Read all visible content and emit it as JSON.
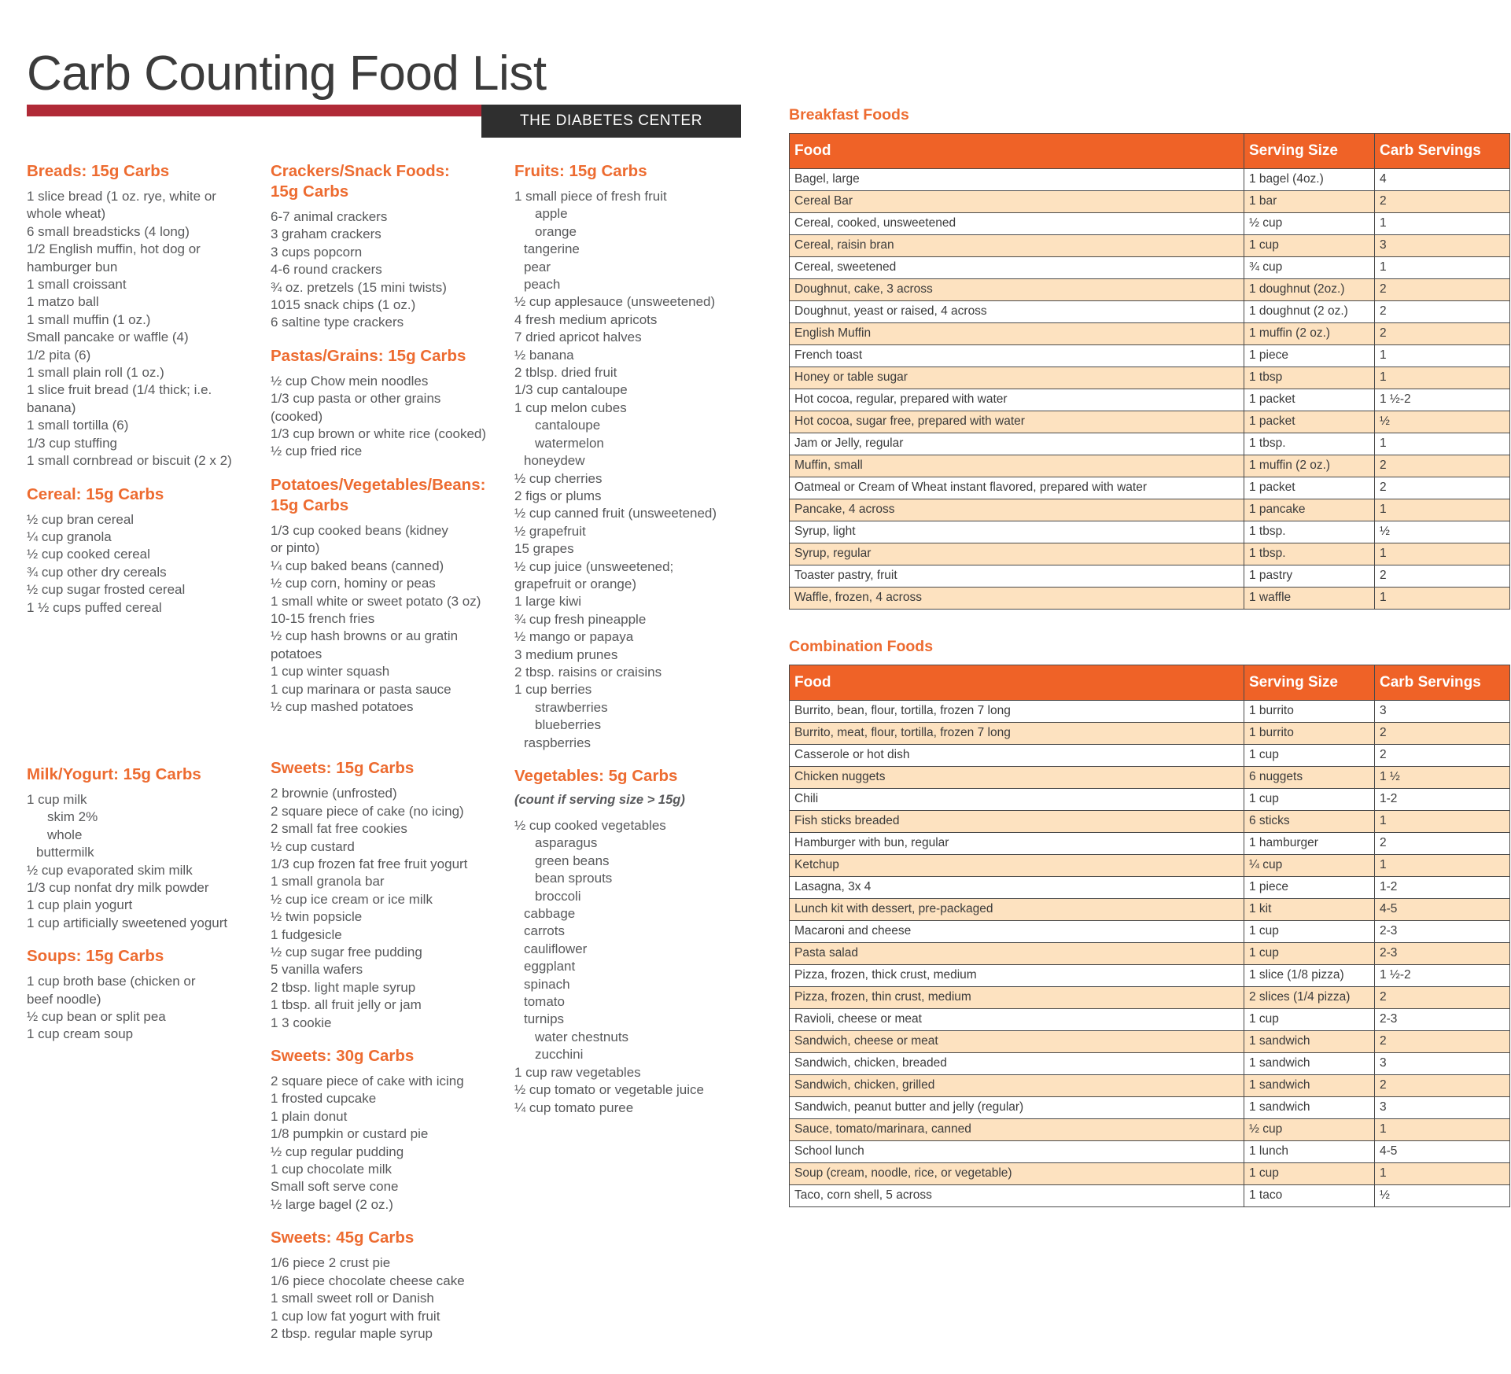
{
  "header": {
    "title": "Carb Counting Food List",
    "badge": "THE DIABETES CENTER",
    "accent_orange": "#ed6b30",
    "accent_red": "#b02a37",
    "badge_bg": "#2f2f2f"
  },
  "columns": [
    {
      "sections": [
        {
          "title": "Breads: 15g Carbs",
          "items": [
            {
              "text": "1 slice bread (1 oz. rye, white or",
              "indent": 0
            },
            {
              "text": "whole wheat)",
              "indent": 0
            },
            {
              "text": "6 small breadsticks (4 long)",
              "indent": 0
            },
            {
              "text": "1/2 English muffin, hot dog or",
              "indent": 0
            },
            {
              "text": "hamburger bun",
              "indent": 0
            },
            {
              "text": "1 small croissant",
              "indent": 0
            },
            {
              "text": "1 matzo ball",
              "indent": 0
            },
            {
              "text": "1 small muffin (1 oz.)",
              "indent": 0
            },
            {
              "text": "Small pancake or waffle (4)",
              "indent": 0
            },
            {
              "text": "1/2 pita (6)",
              "indent": 0
            },
            {
              "text": "1 small plain roll (1 oz.)",
              "indent": 0
            },
            {
              "text": "1 slice fruit bread (1/4 thick; i.e.",
              "indent": 0
            },
            {
              "text": "banana)",
              "indent": 0
            },
            {
              "text": "1 small tortilla (6)",
              "indent": 0
            },
            {
              "text": "1/3 cup stuffing",
              "indent": 0
            },
            {
              "text": "1 small cornbread or biscuit (2 x 2)",
              "indent": 0
            }
          ]
        },
        {
          "title": "Cereal: 15g Carbs",
          "items": [
            {
              "text": "½ cup bran cereal",
              "indent": 0
            },
            {
              "text": "¼ cup granola",
              "indent": 0
            },
            {
              "text": "½ cup cooked cereal",
              "indent": 0
            },
            {
              "text": "¾ cup other dry cereals",
              "indent": 0
            },
            {
              "text": "½ cup sugar frosted cereal",
              "indent": 0
            },
            {
              "text": "1 ½ cups puffed cereal",
              "indent": 0
            }
          ]
        },
        {
          "title": "Milk/Yogurt: 15g Carbs",
          "top_gap": 170,
          "items": [
            {
              "text": "1 cup milk",
              "indent": 0
            },
            {
              "text": "skim 2%",
              "indent": 1
            },
            {
              "text": "whole",
              "indent": 1
            },
            {
              "text": "buttermilk",
              "indent": 2
            },
            {
              "text": "½ cup evaporated skim milk",
              "indent": 0
            },
            {
              "text": "1/3 cup nonfat dry milk powder",
              "indent": 0
            },
            {
              "text": "1 cup plain yogurt",
              "indent": 0
            },
            {
              "text": "1 cup artificially sweetened yogurt",
              "indent": 0
            }
          ]
        },
        {
          "title": "Soups: 15g Carbs",
          "items": [
            {
              "text": "1 cup broth base (chicken or",
              "indent": 0
            },
            {
              "text": "beef noodle)",
              "indent": 0
            },
            {
              "text": "½ cup bean or split pea",
              "indent": 0
            },
            {
              "text": "1 cup cream soup",
              "indent": 0
            }
          ]
        }
      ]
    },
    {
      "sections": [
        {
          "title": "Crackers/Snack Foods:\n15g Carbs",
          "items": [
            {
              "text": "6-7 animal crackers",
              "indent": 0
            },
            {
              "text": "3 graham crackers",
              "indent": 0
            },
            {
              "text": "3 cups popcorn",
              "indent": 0
            },
            {
              "text": "4-6 round crackers",
              "indent": 0
            },
            {
              "text": "¾ oz. pretzels (15 mini twists)",
              "indent": 0
            },
            {
              "text": "1015 snack chips (1 oz.)",
              "indent": 0
            },
            {
              "text": "6 saltine type crackers",
              "indent": 0
            }
          ]
        },
        {
          "title": "Pastas/Grains: 15g Carbs",
          "items": [
            {
              "text": "½ cup Chow mein noodles",
              "indent": 0
            },
            {
              "text": "1/3 cup pasta or other grains",
              "indent": 0
            },
            {
              "text": "(cooked)",
              "indent": 0
            },
            {
              "text": "1/3 cup brown or white rice (cooked)",
              "indent": 0
            },
            {
              "text": "½ cup fried rice",
              "indent": 0
            }
          ]
        },
        {
          "title": "Potatoes/Vegetables/Beans:\n15g Carbs",
          "items": [
            {
              "text": "1/3 cup cooked beans (kidney",
              "indent": 0
            },
            {
              "text": "or pinto)",
              "indent": 0
            },
            {
              "text": "¼ cup baked beans (canned)",
              "indent": 0
            },
            {
              "text": "½ cup corn, hominy or peas",
              "indent": 0
            },
            {
              "text": "1 small white or sweet potato (3 oz)",
              "indent": 0
            },
            {
              "text": "10-15 french fries",
              "indent": 0
            },
            {
              "text": "½ cup hash browns or au gratin",
              "indent": 0
            },
            {
              "text": "potatoes",
              "indent": 0
            },
            {
              "text": "1 cup winter squash",
              "indent": 0
            },
            {
              "text": "1 cup marinara or pasta sauce",
              "indent": 0
            },
            {
              "text": "½ cup mashed potatoes",
              "indent": 0
            }
          ]
        },
        {
          "title": "Sweets: 15g Carbs",
          "top_gap": 36,
          "items": [
            {
              "text": "2 brownie (unfrosted)",
              "indent": 0
            },
            {
              "text": "2 square piece of cake (no icing)",
              "indent": 0
            },
            {
              "text": "2 small fat free cookies",
              "indent": 0
            },
            {
              "text": "½ cup custard",
              "indent": 0
            },
            {
              "text": "1/3 cup frozen fat free fruit yogurt",
              "indent": 0
            },
            {
              "text": "1 small granola bar",
              "indent": 0
            },
            {
              "text": "½ cup ice cream or ice milk",
              "indent": 0
            },
            {
              "text": "½ twin popsicle",
              "indent": 0
            },
            {
              "text": "1 fudgesicle",
              "indent": 0
            },
            {
              "text": "½ cup sugar free pudding",
              "indent": 0
            },
            {
              "text": "5 vanilla wafers",
              "indent": 0
            },
            {
              "text": "2 tbsp. light maple syrup",
              "indent": 0
            },
            {
              "text": "1 tbsp. all fruit jelly or jam",
              "indent": 0
            },
            {
              "text": "1 3 cookie",
              "indent": 0
            }
          ]
        },
        {
          "title": "Sweets: 30g Carbs",
          "items": [
            {
              "text": "2 square piece of cake with icing",
              "indent": 0
            },
            {
              "text": "1 frosted cupcake",
              "indent": 0
            },
            {
              "text": "1 plain donut",
              "indent": 0
            },
            {
              "text": "1/8 pumpkin or custard pie",
              "indent": 0
            },
            {
              "text": "½ cup regular pudding",
              "indent": 0
            },
            {
              "text": "1 cup chocolate milk",
              "indent": 0
            },
            {
              "text": "Small soft serve cone",
              "indent": 0
            },
            {
              "text": "½ large bagel (2 oz.)",
              "indent": 0
            }
          ]
        },
        {
          "title": "Sweets: 45g Carbs",
          "items": [
            {
              "text": "1/6 piece 2 crust pie",
              "indent": 0
            },
            {
              "text": "1/6 piece chocolate cheese cake",
              "indent": 0
            },
            {
              "text": "1 small sweet roll or Danish",
              "indent": 0
            },
            {
              "text": "1 cup low fat yogurt with fruit",
              "indent": 0
            },
            {
              "text": "2 tbsp. regular maple syrup",
              "indent": 0
            }
          ]
        }
      ]
    },
    {
      "sections": [
        {
          "title": "Fruits: 15g Carbs",
          "items": [
            {
              "text": "1 small piece of fresh fruit",
              "indent": 0
            },
            {
              "text": "apple",
              "indent": 1
            },
            {
              "text": "orange",
              "indent": 1
            },
            {
              "text": "tangerine",
              "indent": 2
            },
            {
              "text": "pear",
              "indent": 2
            },
            {
              "text": "peach",
              "indent": 2
            },
            {
              "text": "½ cup applesauce (unsweetened)",
              "indent": 0
            },
            {
              "text": "4 fresh medium apricots",
              "indent": 0
            },
            {
              "text": "7 dried apricot halves",
              "indent": 0
            },
            {
              "text": "½ banana",
              "indent": 0
            },
            {
              "text": "2 tblsp. dried fruit",
              "indent": 0
            },
            {
              "text": "1/3 cup cantaloupe",
              "indent": 0
            },
            {
              "text": "1 cup melon cubes",
              "indent": 0
            },
            {
              "text": "cantaloupe",
              "indent": 1
            },
            {
              "text": "watermelon",
              "indent": 1
            },
            {
              "text": "honeydew",
              "indent": 2
            },
            {
              "text": "½ cup cherries",
              "indent": 0
            },
            {
              "text": "2 figs or plums",
              "indent": 0
            },
            {
              "text": "½ cup canned fruit (unsweetened)",
              "indent": 0
            },
            {
              "text": "½ grapefruit",
              "indent": 0
            },
            {
              "text": "15 grapes",
              "indent": 0
            },
            {
              "text": "½ cup juice (unsweetened;",
              "indent": 0
            },
            {
              "text": "grapefruit or orange)",
              "indent": 0
            },
            {
              "text": "1 large kiwi",
              "indent": 0
            },
            {
              "text": "¾ cup fresh pineapple",
              "indent": 0
            },
            {
              "text": "½ mango or papaya",
              "indent": 0
            },
            {
              "text": "3 medium prunes",
              "indent": 0
            },
            {
              "text": "2 tbsp. raisins or craisins",
              "indent": 0
            },
            {
              "text": "1 cup berries",
              "indent": 0
            },
            {
              "text": "strawberries",
              "indent": 1
            },
            {
              "text": "blueberries",
              "indent": 1
            },
            {
              "text": "raspberries",
              "indent": 2
            }
          ]
        },
        {
          "title": "Vegetables: 5g Carbs",
          "note": "(count if serving size > 15g)",
          "items": [
            {
              "text": "½ cup cooked vegetables",
              "indent": 0
            },
            {
              "text": "asparagus",
              "indent": 1
            },
            {
              "text": "green beans",
              "indent": 1
            },
            {
              "text": "bean sprouts",
              "indent": 1
            },
            {
              "text": "broccoli",
              "indent": 1
            },
            {
              "text": "cabbage",
              "indent": 2
            },
            {
              "text": "carrots",
              "indent": 2
            },
            {
              "text": "cauliflower",
              "indent": 2
            },
            {
              "text": "eggplant",
              "indent": 2
            },
            {
              "text": "spinach",
              "indent": 2
            },
            {
              "text": "tomato",
              "indent": 2
            },
            {
              "text": "turnips",
              "indent": 2
            },
            {
              "text": "water chestnuts",
              "indent": 1
            },
            {
              "text": "zucchini",
              "indent": 1
            },
            {
              "text": "1 cup raw vegetables",
              "indent": 0
            },
            {
              "text": "½ cup tomato or vegetable juice",
              "indent": 0
            },
            {
              "text": "¼ cup tomato puree",
              "indent": 0
            }
          ]
        }
      ]
    }
  ],
  "tables": [
    {
      "title": "Breakfast Foods",
      "headers": [
        "Food",
        "Serving Size",
        "Carb Servings"
      ],
      "rows": [
        [
          "Bagel, large",
          "1 bagel (4oz.)",
          "4"
        ],
        [
          "Cereal Bar",
          "1 bar",
          "2"
        ],
        [
          "Cereal, cooked, unsweetened",
          "½ cup",
          "1"
        ],
        [
          "Cereal, raisin bran",
          "1 cup",
          "3"
        ],
        [
          "Cereal, sweetened",
          "¾ cup",
          "1"
        ],
        [
          "Doughnut, cake, 3 across",
          "1 doughnut (2oz.)",
          "2"
        ],
        [
          "Doughnut, yeast or raised, 4 across",
          "1 doughnut (2 oz.)",
          "2"
        ],
        [
          "English Muffin",
          "1 muffin (2 oz.)",
          "2"
        ],
        [
          "French toast",
          "1 piece",
          "1"
        ],
        [
          "Honey or table sugar",
          "1 tbsp",
          "1"
        ],
        [
          "Hot cocoa, regular, prepared with water",
          "1 packet",
          "1 ½-2"
        ],
        [
          "Hot cocoa, sugar free, prepared with water",
          "1 packet",
          "½"
        ],
        [
          "Jam or Jelly, regular",
          "1 tbsp.",
          "1"
        ],
        [
          "Muffin, small",
          "1 muffin (2 oz.)",
          "2"
        ],
        [
          "Oatmeal or Cream of Wheat instant flavored, prepared with water",
          "1 packet",
          "2"
        ],
        [
          "Pancake, 4 across",
          "1 pancake",
          "1"
        ],
        [
          "Syrup, light",
          "1 tbsp.",
          "½"
        ],
        [
          "Syrup, regular",
          "1 tbsp.",
          "1"
        ],
        [
          "Toaster pastry, fruit",
          "1 pastry",
          "2"
        ],
        [
          "Waffle, frozen, 4 across",
          "1 waffle",
          "1"
        ]
      ]
    },
    {
      "title": "Combination Foods",
      "headers": [
        "Food",
        "Serving Size",
        "Carb Servings"
      ],
      "rows": [
        [
          "Burrito, bean, flour, tortilla, frozen 7 long",
          "1 burrito",
          "3"
        ],
        [
          "Burrito, meat, flour, tortilla, frozen 7 long",
          "1 burrito",
          "2"
        ],
        [
          "Casserole or hot dish",
          "1 cup",
          "2"
        ],
        [
          "Chicken nuggets",
          "6 nuggets",
          "1 ½"
        ],
        [
          "Chili",
          "1 cup",
          "1-2"
        ],
        [
          "Fish sticks breaded",
          "6 sticks",
          "1"
        ],
        [
          "Hamburger with bun, regular",
          "1 hamburger",
          "2"
        ],
        [
          "Ketchup",
          "¼ cup",
          "1"
        ],
        [
          "Lasagna, 3x 4",
          "1 piece",
          "1-2"
        ],
        [
          "Lunch kit with dessert, pre-packaged",
          "1 kit",
          "4-5"
        ],
        [
          "Macaroni and cheese",
          "1 cup",
          "2-3"
        ],
        [
          "Pasta salad",
          "1 cup",
          "2-3"
        ],
        [
          "Pizza, frozen, thick crust, medium",
          "1 slice (1/8 pizza)",
          "1 ½-2"
        ],
        [
          "Pizza, frozen, thin crust, medium",
          "2 slices (1/4 pizza)",
          "2"
        ],
        [
          "Ravioli, cheese or meat",
          "1 cup",
          "2-3"
        ],
        [
          "Sandwich, cheese or meat",
          "1 sandwich",
          "2"
        ],
        [
          "Sandwich, chicken, breaded",
          "1 sandwich",
          "3"
        ],
        [
          "Sandwich, chicken, grilled",
          "1 sandwich",
          "2"
        ],
        [
          "Sandwich, peanut butter and jelly (regular)",
          "1 sandwich",
          "3"
        ],
        [
          "Sauce, tomato/marinara, canned",
          "½ cup",
          "1"
        ],
        [
          "School lunch",
          "1 lunch",
          "4-5"
        ],
        [
          "Soup (cream, noodle, rice, or vegetable)",
          "1 cup",
          "1"
        ],
        [
          "Taco, corn shell, 5 across",
          "1 taco",
          "½"
        ]
      ]
    }
  ]
}
